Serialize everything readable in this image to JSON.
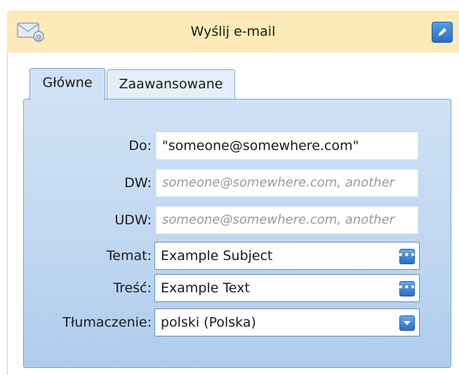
{
  "header": {
    "title": "Wyślij e-mail",
    "mail_icon": "mail-icon",
    "edit_icon": "pencil-icon"
  },
  "tabs": [
    {
      "label": "Główne",
      "active": true
    },
    {
      "label": "Zaawansowane",
      "active": false
    }
  ],
  "form": {
    "to_label": "Do:",
    "to_value": "\"someone@somewhere.com\"",
    "cc_label": "DW:",
    "cc_placeholder": "someone@somewhere.com, another",
    "bcc_label": "UDW:",
    "bcc_placeholder": "someone@somewhere.com, another",
    "subject_label": "Temat:",
    "subject_value": "Example Subject",
    "body_label": "Treść:",
    "body_value": "Example Text",
    "translation_label": "Tłumaczenie:",
    "translation_value": "polski (Polska)"
  },
  "colors": {
    "header_bg": "#fdeab8",
    "panel_bg": "#c0d7f1",
    "button_blue": "#2b6cc0"
  }
}
